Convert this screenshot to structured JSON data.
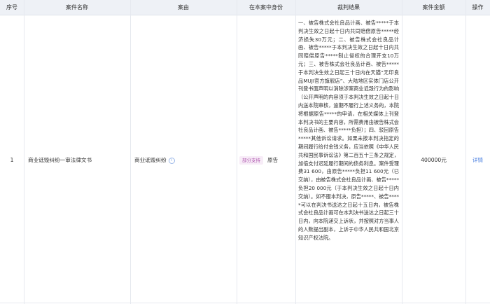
{
  "header": {
    "index": "序号",
    "case_name": "案件名称",
    "cause": "案由",
    "role": "在本案中身份",
    "result": "裁判结果",
    "amount": "案件金额",
    "action": "操作"
  },
  "rows": [
    {
      "index": "1",
      "case_name": "商业诋毁纠纷一审法律文书",
      "cause": "商业诋毁纠纷",
      "badge": "部分支持",
      "role": "原告",
      "result": "一、被告株式会社良品计画、被告*****于本判决生效之日起十日内共同赔偿原告*****经济损失30万元；二、被告株式会社良品计画、被告*****于本判决生效之日起十日内共同赔偿原告*****制止侵权的合理开支10万元；三、被告株式会社良品计画、被告*****于本判决生效之日起三十日内在天猫“无印良品MUJI官方旗舰店”、大陆地区实体门店公开刊登书面声明以消除涉案商业诋毁行为的影响（公开声明的内容须于本判决生效之日起十日内送本院审核，逾期不履行上述义务的，本院将根据原告*****的申请，在相关媒体上刊登本判决书的主要内容，所需费用由被告株式会社良品计画、被告*****负担）；四、驳回原告*****其他诉讼请求。如果未按本判决指定的期间履行给付金钱义务，应当依照《中华人民共和国民事诉讼法》第二百五十三条之规定，加倍支付迟延履行期间的债务利息。案件受理费31 600，由原告*****负担11 600元（已交纳），由被告株式会社良品计画、被告*****负担20 000元（于本判决生效之日起十日内交纳）。如不服本判决，原告*****、被告*****可以在判决书送达之日起十五日内，被告株式会社良品计画可在本判决书送达之日起三十日内，向本院递交上诉状，并按照对方当事人的人数提出副本，上诉于中华人民共和国北京知识产权法院。",
      "amount": "400000元",
      "action": "详情"
    }
  ],
  "icons": {
    "cause_info": "info-circle-icon"
  },
  "colors": {
    "header_bg": "#eef1f6",
    "link": "#4a7fe0",
    "badge_bg": "#f7ecf7",
    "badge_text": "#b05ab0"
  }
}
